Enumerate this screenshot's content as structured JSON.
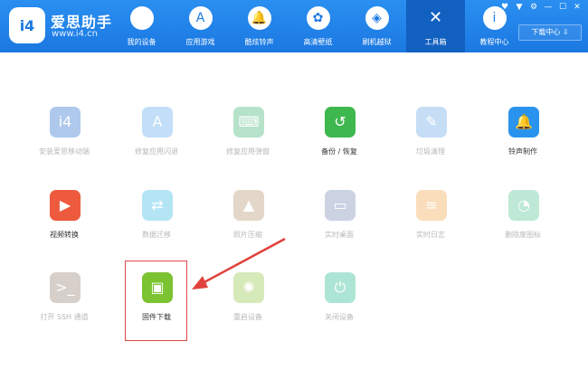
{
  "header": {
    "logo_text": "i4",
    "brand_name": "爱思助手",
    "brand_url": "www.i4.cn",
    "download_center": "下载中心 ⇩",
    "window_controls": [
      "♥",
      "▼",
      "⚙",
      "—",
      "☐",
      "✕"
    ]
  },
  "nav": [
    {
      "label": "我的设备",
      "icon": "apple-icon",
      "glyph": ""
    },
    {
      "label": "应用游戏",
      "icon": "app-store-icon",
      "glyph": "A"
    },
    {
      "label": "酷炫铃声",
      "icon": "bell-icon",
      "glyph": "🔔"
    },
    {
      "label": "高清壁纸",
      "icon": "flower-icon",
      "glyph": "✿"
    },
    {
      "label": "刷机越狱",
      "icon": "box-icon",
      "glyph": "◈"
    },
    {
      "label": "工具箱",
      "icon": "tools-icon",
      "glyph": "✕",
      "active": true
    },
    {
      "label": "教程中心",
      "icon": "info-icon",
      "glyph": "i"
    }
  ],
  "tools": [
    {
      "label": "安装爱思移动端",
      "icon": "i4-icon",
      "color": "#4f89d8",
      "enabled": false,
      "glyph": "i4"
    },
    {
      "label": "修复应用闪退",
      "icon": "app-store-icon",
      "color": "#79b7f0",
      "enabled": false,
      "glyph": "A"
    },
    {
      "label": "修复应用弹窗",
      "icon": "keyboard-icon",
      "color": "#5cbf8a",
      "enabled": false,
      "glyph": "⌨"
    },
    {
      "label": "备份 / 恢复",
      "icon": "restore-icon",
      "color": "#3db74e",
      "enabled": true,
      "glyph": "↺"
    },
    {
      "label": "垃圾清理",
      "icon": "broom-icon",
      "color": "#7fb7ea",
      "enabled": false,
      "glyph": "✎"
    },
    {
      "label": "铃声制作",
      "icon": "bell-plus-icon",
      "color": "#2993ee",
      "enabled": true,
      "glyph": "🔔"
    },
    {
      "label": "视频转换",
      "icon": "video-icon",
      "color": "#ee5a3e",
      "enabled": true,
      "glyph": "▶"
    },
    {
      "label": "数据迁移",
      "icon": "migrate-icon",
      "color": "#5bc6e8",
      "enabled": false,
      "glyph": "⇄"
    },
    {
      "label": "照片压缩",
      "icon": "photo-icon",
      "color": "#c2a889",
      "enabled": false,
      "glyph": "▲"
    },
    {
      "label": "实时桌面",
      "icon": "monitor-icon",
      "color": "#8ea0c2",
      "enabled": false,
      "glyph": "▭"
    },
    {
      "label": "实时日志",
      "icon": "document-icon",
      "color": "#f5b46a",
      "enabled": false,
      "glyph": "≡"
    },
    {
      "label": "删除废图标",
      "icon": "pie-icon",
      "color": "#6ed0a6",
      "enabled": false,
      "glyph": "◔"
    },
    {
      "label": "打开 SSH 通道",
      "icon": "terminal-icon",
      "color": "#a8968a",
      "enabled": false,
      "glyph": ">_"
    },
    {
      "label": "固件下载",
      "icon": "cube-icon",
      "color": "#7cc332",
      "enabled": true,
      "glyph": "▣"
    },
    {
      "label": "重启设备",
      "icon": "loading-icon",
      "color": "#a5cf66",
      "enabled": false,
      "glyph": "✺"
    },
    {
      "label": "关闭设备",
      "icon": "power-icon",
      "color": "#4cc7a2",
      "enabled": false,
      "glyph": "⏻"
    }
  ]
}
